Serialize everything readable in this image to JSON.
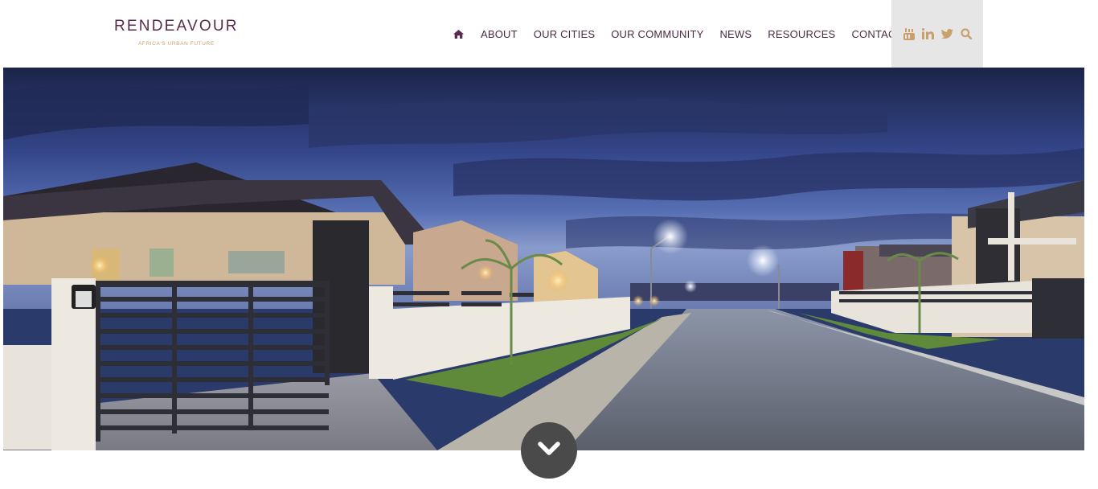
{
  "brand": {
    "name": "RENDEAVOUR",
    "tagline": "AFRICA'S URBAN FUTURE"
  },
  "nav": {
    "home_icon": "home-icon",
    "items": [
      {
        "label": "ABOUT"
      },
      {
        "label": "OUR CITIES"
      },
      {
        "label": "OUR COMMUNITY"
      },
      {
        "label": "NEWS"
      },
      {
        "label": "RESOURCES"
      },
      {
        "label": "CONTACT"
      }
    ]
  },
  "social": {
    "icons": [
      "youtube-icon",
      "linkedin-icon",
      "twitter-icon",
      "search-icon"
    ],
    "accent": "#c9a06a"
  },
  "colors": {
    "brand": "#5a2a4e",
    "nav_text": "#4a2a44",
    "scroll_button": "#4a4a4a"
  },
  "hero": {
    "scroll_icon": "chevron-down-icon"
  }
}
